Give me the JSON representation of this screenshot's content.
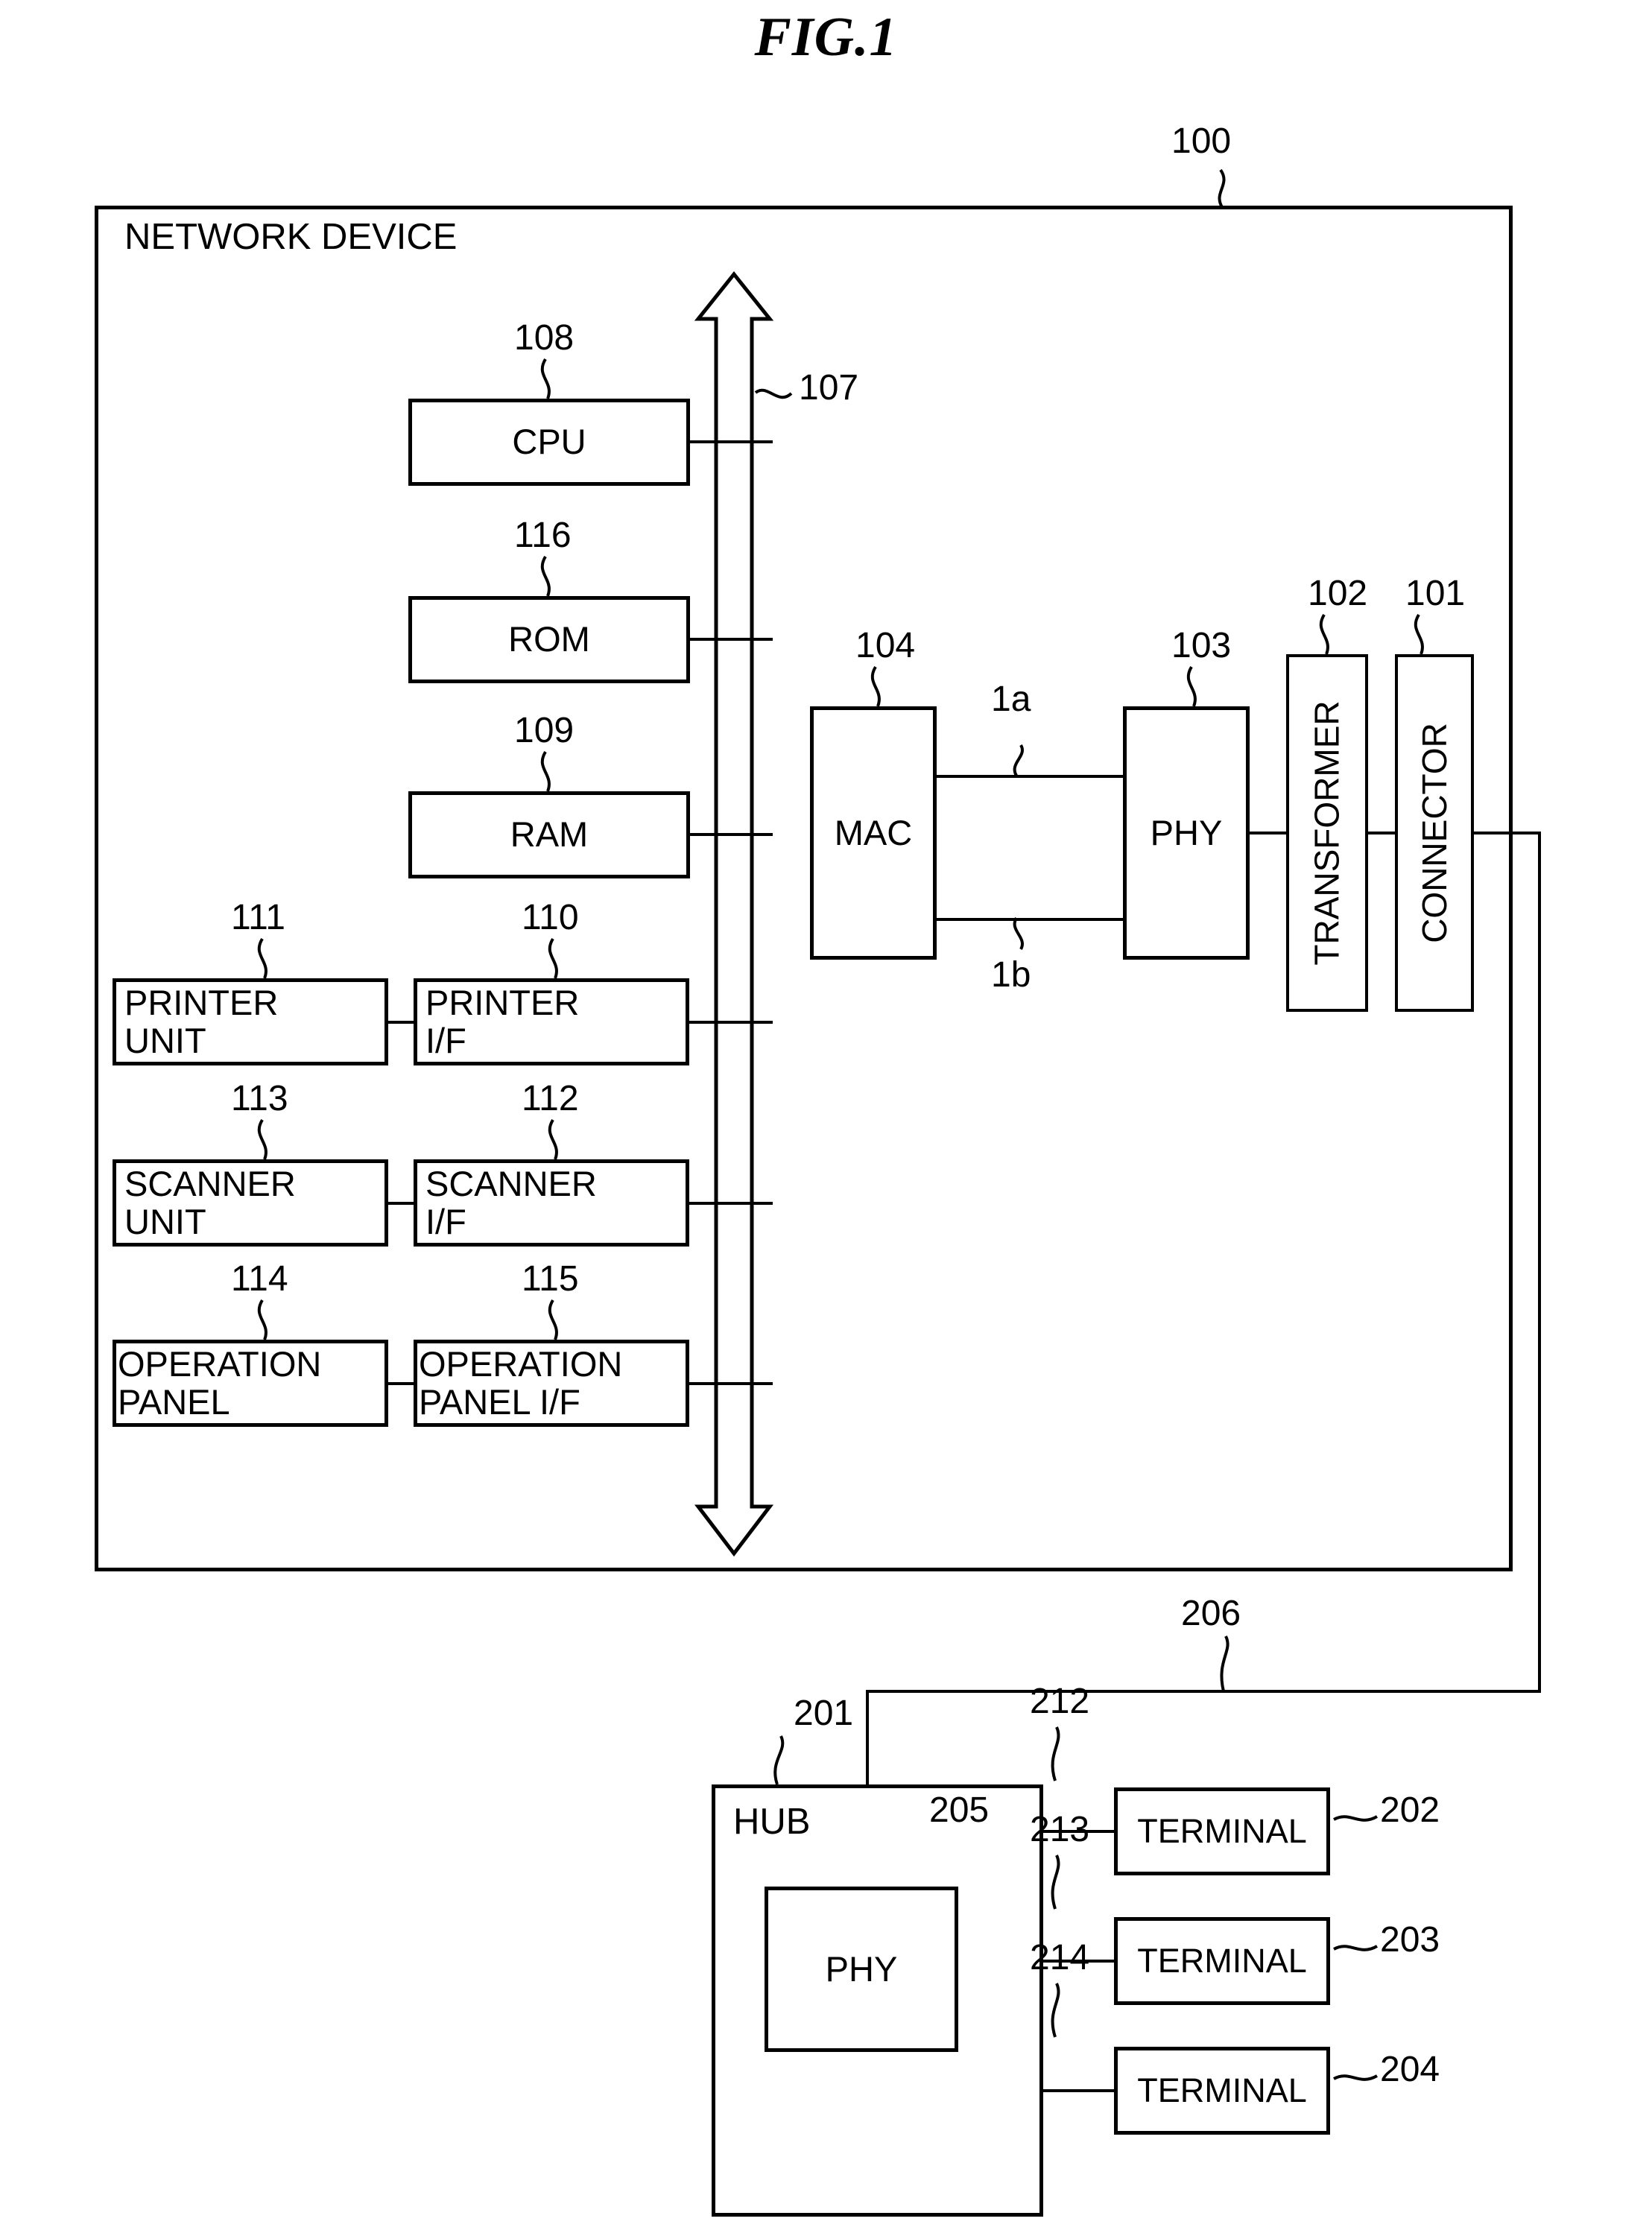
{
  "figure": {
    "title": "FIG.1"
  },
  "network_device": {
    "label": "NETWORK DEVICE",
    "ref": "100",
    "bus_ref": "107",
    "blocks": [
      {
        "id": "cpu",
        "label": "CPU",
        "ref": "108"
      },
      {
        "id": "rom",
        "label": "ROM",
        "ref": "116"
      },
      {
        "id": "ram",
        "label": "RAM",
        "ref": "109"
      },
      {
        "id": "printer_unit",
        "label": "PRINTER\nUNIT",
        "ref": "111"
      },
      {
        "id": "printer_if",
        "label": "PRINTER\nI/F",
        "ref": "110"
      },
      {
        "id": "scanner_unit",
        "label": "SCANNER\nUNIT",
        "ref": "113"
      },
      {
        "id": "scanner_if",
        "label": "SCANNER\nI/F",
        "ref": "112"
      },
      {
        "id": "operation_panel",
        "label": "OPERATION\nPANEL",
        "ref": "114"
      },
      {
        "id": "operation_panel_if",
        "label": "OPERATION\nPANEL I/F",
        "ref": "115"
      },
      {
        "id": "mac",
        "label": "MAC",
        "ref": "104"
      },
      {
        "id": "phy",
        "label": "PHY",
        "ref": "103"
      },
      {
        "id": "transformer",
        "label": "TRANSFORMER",
        "ref": "102"
      },
      {
        "id": "connector",
        "label": "CONNECTOR",
        "ref": "101"
      }
    ],
    "mac_phy_links": [
      {
        "id": "link_1a",
        "ref": "1a"
      },
      {
        "id": "link_1b",
        "ref": "1b"
      }
    ]
  },
  "network": {
    "cable_ref": "206",
    "hub": {
      "label": "HUB",
      "ref": "201",
      "phy": {
        "label": "PHY",
        "ref": "205"
      }
    },
    "ports": [
      {
        "id": "port_212",
        "ref": "212"
      },
      {
        "id": "port_213",
        "ref": "213"
      },
      {
        "id": "port_214",
        "ref": "214"
      }
    ],
    "terminals": [
      {
        "id": "terminal_202",
        "label": "TERMINAL",
        "ref": "202"
      },
      {
        "id": "terminal_203",
        "label": "TERMINAL",
        "ref": "203"
      },
      {
        "id": "terminal_204",
        "label": "TERMINAL",
        "ref": "204"
      }
    ]
  },
  "colors": {
    "ink": "#000000",
    "paper": "#ffffff"
  }
}
